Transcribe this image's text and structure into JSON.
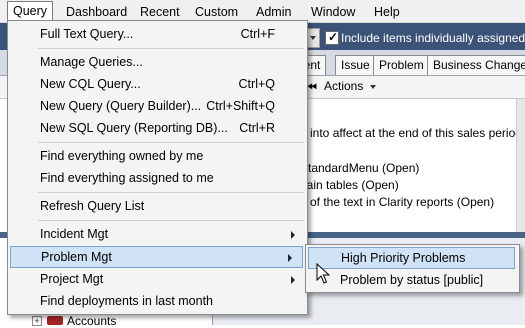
{
  "menubar": {
    "items": [
      "Query",
      "Dashboard",
      "Recent",
      "Custom",
      "Admin",
      "Window",
      "Help"
    ],
    "active": "Query"
  },
  "toolbar": {
    "include_checkbox_label": "Include items individually assigned",
    "include_checked": true
  },
  "tabs": [
    "dent",
    "Issue",
    "Problem",
    "Business Change"
  ],
  "actions": {
    "nav_glyph": "⏮",
    "label": "Actions"
  },
  "content": {
    "lines": [
      "e into affect at the end of this sales period",
      "StandardMenu (Open)",
      "nain tables (Open)",
      "e of the text in Clarity reports (Open)"
    ]
  },
  "tree": {
    "expander": "+",
    "label": "Accounts"
  },
  "query_menu": {
    "items": [
      {
        "label": "Full Text Query...",
        "shortcut": "Ctrl+F"
      },
      {
        "label": "Manage Queries..."
      },
      {
        "label": "New CQL Query...",
        "shortcut": "Ctrl+Q"
      },
      {
        "label": "New Query (Query Builder)...",
        "shortcut": "Ctrl+Shift+Q"
      },
      {
        "label": "New SQL Query (Reporting DB)...",
        "shortcut": "Ctrl+R"
      },
      {
        "label": "Find everything owned by me"
      },
      {
        "label": "Find everything assigned to me"
      },
      {
        "label": "Refresh Query List"
      },
      {
        "label": "Incident Mgt",
        "submenu": true
      },
      {
        "label": "Problem Mgt",
        "submenu": true,
        "highlighted": true
      },
      {
        "label": "Project Mgt",
        "submenu": true
      },
      {
        "label": "Find deployments in last month"
      }
    ]
  },
  "problem_submenu": {
    "items": [
      {
        "label": "High Priority Problems",
        "highlighted": true
      },
      {
        "label": "Problem by status [public]"
      }
    ]
  },
  "colors": {
    "toolbar_bg": "#3b5379",
    "highlight_bg": "#cfe2f6",
    "highlight_border": "#7da2ce",
    "menu_bg": "#f4f4f4"
  }
}
